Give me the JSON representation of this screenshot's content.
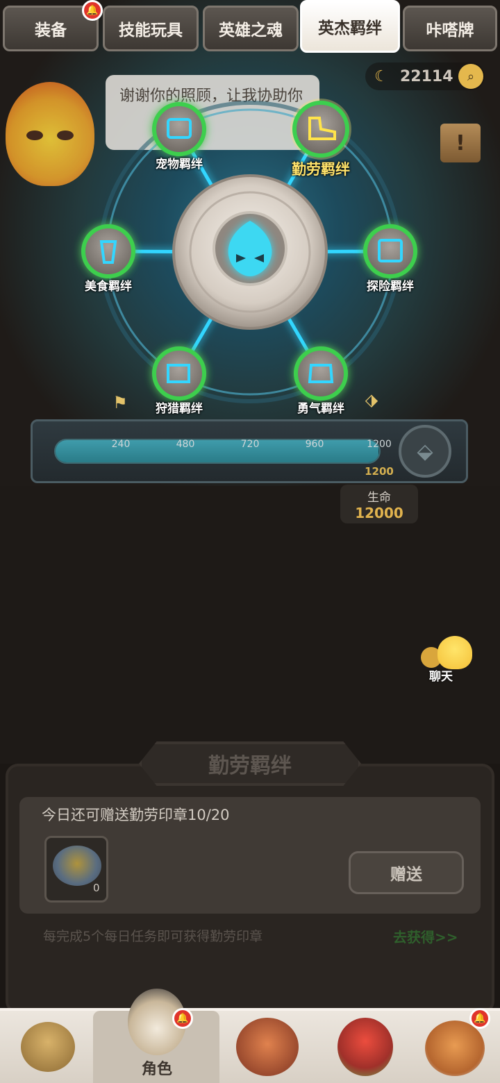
{
  "tabs": [
    {
      "label": "装备",
      "active": false,
      "badge": true
    },
    {
      "label": "技能玩具",
      "active": false,
      "badge": false
    },
    {
      "label": "英雄之魂",
      "active": false,
      "badge": false
    },
    {
      "label": "英杰羁绊",
      "active": true,
      "badge": false
    },
    {
      "label": "咔嗒牌",
      "active": false,
      "badge": false
    }
  ],
  "currency": {
    "icon": "banana-icon",
    "value": "22114"
  },
  "speech": {
    "text": "谢谢你的照顾，让我协助你"
  },
  "bonds": {
    "nodes": [
      {
        "label": "宠物羁绊",
        "icon": "pet-icon"
      },
      {
        "label": "勤劳羁绊",
        "icon": "boot-icon",
        "selected": true
      },
      {
        "label": "美食羁绊",
        "icon": "cup-icon"
      },
      {
        "label": "探险羁绊",
        "icon": "map-icon"
      },
      {
        "label": "狩猎羁绊",
        "icon": "fish-icon"
      },
      {
        "label": "勇气羁绊",
        "icon": "beast-icon"
      }
    ],
    "center_icon": "flame-spirit-icon"
  },
  "progress": {
    "ticks": [
      "240",
      "480",
      "720",
      "960",
      "1200"
    ],
    "fraction": 0.998,
    "current": "1200",
    "reward_label": "生命",
    "reward_value": "12000"
  },
  "chat": {
    "label": "聊天"
  },
  "panel": {
    "title": "勤劳羁绊",
    "daily_text": "今日还可赠送勤劳印章10/20",
    "item_count": "0",
    "gift_button": "赠送",
    "hint": "每完成5个每日任务即可获得勤劳印章",
    "get_link": "去获得>>"
  },
  "nav": {
    "items": [
      {
        "name": "caveman",
        "label": ""
      },
      {
        "name": "character",
        "label": "角色",
        "active": true,
        "badge": true
      },
      {
        "name": "totem",
        "label": ""
      },
      {
        "name": "dino",
        "label": ""
      },
      {
        "name": "golem",
        "label": "",
        "badge": true
      }
    ]
  },
  "colors": {
    "glow": "#33d6ff",
    "ring_green": "#3ccf4e",
    "selected_gold": "#ffe36b"
  }
}
